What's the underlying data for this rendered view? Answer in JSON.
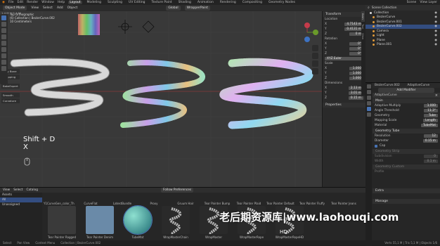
{
  "topbar": {
    "menus": [
      "File",
      "Edit",
      "Render",
      "Window",
      "Help"
    ],
    "workspaces": [
      "Layout",
      "Modeling",
      "Sculpting",
      "UV Editing",
      "Texture Paint",
      "Shading",
      "Animation",
      "Rendering",
      "Compositing",
      "Geometry Nodes"
    ],
    "active_workspace": "Layout",
    "scene": "Scene",
    "view_layer": "View Layer"
  },
  "header": {
    "mode": "Object Mode",
    "menus": [
      "View",
      "Select",
      "Add",
      "Object"
    ],
    "transform": "Global",
    "addon": "WrapperPaint"
  },
  "viewport": {
    "info_line1": "Top Orthographic",
    "info_line2": "(6) Collection | BezierCurve.002",
    "info_line3": "10 Centimeters",
    "stats": "1.4 M (+5.1 M) ...",
    "side_tools": [
      "Lazy Bone",
      "Wrapping",
      "BakeExpert",
      "Smooth",
      "Curvature"
    ],
    "overlay_key1": "Shift + D",
    "overlay_key2": "X"
  },
  "npanel": {
    "transform_title": "Transform",
    "location_label": "Location",
    "location": [
      "4.7143 m",
      "0.4131 m",
      "0 m"
    ],
    "rotation_label": "Rotation",
    "rotation": [
      "0°",
      "0°",
      "0°"
    ],
    "mode": "XYZ Euler",
    "scale_label": "Scale",
    "scale": [
      "1.000",
      "1.000",
      "1.000"
    ],
    "dimensions_label": "Dimensions",
    "dimensions": [
      "2.13 m",
      "3.01 m",
      "0.15 m"
    ],
    "properties_label": "Properties",
    "tabs": [
      "Item",
      "Tool",
      "View"
    ]
  },
  "outliner": {
    "header": "Scene Collection",
    "items": [
      {
        "label": "Collection",
        "selected": false
      },
      {
        "label": "BezierCurve",
        "selected": false
      },
      {
        "label": "BezierCurve.001",
        "selected": false
      },
      {
        "label": "BezierCurve.002",
        "selected": true
      },
      {
        "label": "Camera",
        "selected": false
      },
      {
        "label": "Light",
        "selected": false
      },
      {
        "label": "Plane",
        "selected": false
      },
      {
        "label": "Plane.001",
        "selected": false
      }
    ]
  },
  "properties": {
    "breadcrumb_obj": "BezierCurve.002",
    "breadcrumb_mod": "AdaptiveCurve",
    "add_modifier": "Add Modifier",
    "modifier_name": "AdaptiveCurve",
    "main_title": "Main",
    "adaptive_multiply_label": "Adaptive Multiply",
    "adaptive_multiply": "1.000",
    "angle_threshold_label": "Angle Threshold",
    "angle_threshold": "11.3°",
    "geometry_label": "Geometry",
    "geometry": "Tube",
    "mapping_scale_label": "Mapping Scale",
    "mapping_scale": "Length",
    "material_label": "Material",
    "material": "TubeMat",
    "geometry_tube_title": "Geometry Tube",
    "resolution_label": "Resolution",
    "resolution": "12",
    "diameter_label": "Diameter",
    "diameter": "0.15 m",
    "cap_label": "Cap",
    "geometry_strip_title": "Geometry Strip",
    "subdivision_label": "Subdivision",
    "subdivision": "0",
    "width_label": "Width",
    "width": "0.1 m",
    "geometry_custom_title": "Geometry Custom",
    "profile_label": "Profile",
    "extra_title": "Extra",
    "manage_title": "Manage"
  },
  "bottom": {
    "menus": [
      "View",
      "Select",
      "Catalog"
    ],
    "top_label": "Follow Preferences",
    "left_items": [
      "Assets",
      "All",
      "Unassigned"
    ],
    "top_row": [
      "Y1CurveGen_color_Thread",
      "CurveFlat",
      "LatestBundle",
      "Proxy",
      "Gruum Hair",
      "Tear Painter Bump",
      "Tear Painter Plaid",
      "Tear Painter Default",
      "Tear Painter Fluffy",
      "Tear Painter Jeans"
    ],
    "assets": [
      {
        "label": "Tear Painter Ragged"
      },
      {
        "label": "Tear Painter Denim"
      },
      {
        "label": "TubeMat"
      },
      {
        "label": "WrapMasterChain"
      },
      {
        "label": "WrapMaster"
      },
      {
        "label": "WrapMasterRope"
      },
      {
        "label": "WrapMasterRopeHD"
      }
    ],
    "hd_label": "HD"
  },
  "watermark": "老后期资源库|www.laohouqi.com",
  "statusbar": [
    "Select",
    "Pan View",
    "Context Menu",
    "Collection | BezierCurve.002",
    "Verts 55,1 M | Tris 5,1 M | Objects 1/6"
  ]
}
